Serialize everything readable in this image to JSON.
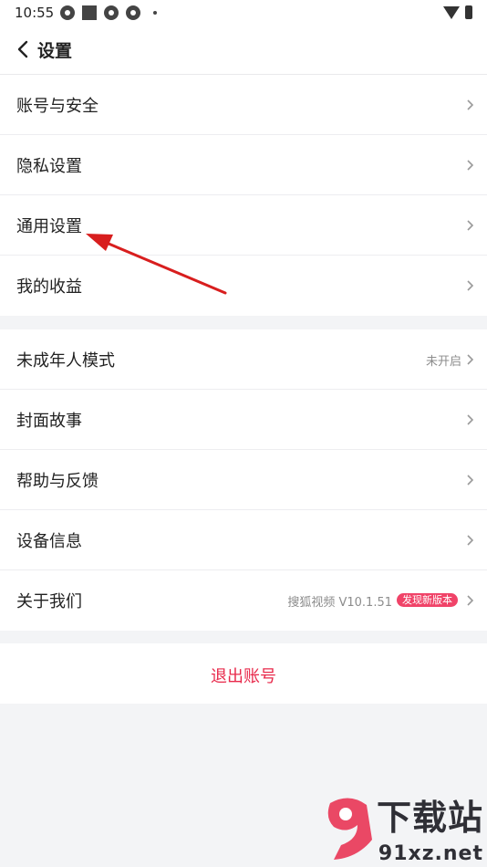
{
  "status_bar": {
    "time": "10:55"
  },
  "header": {
    "title": "设置"
  },
  "group1": [
    {
      "label": "账号与安全"
    },
    {
      "label": "隐私设置"
    },
    {
      "label": "通用设置"
    },
    {
      "label": "我的收益"
    }
  ],
  "group2": [
    {
      "label": "未成年人模式",
      "value": "未开启"
    },
    {
      "label": "封面故事"
    },
    {
      "label": "帮助与反馈"
    },
    {
      "label": "设备信息"
    },
    {
      "label": "关于我们",
      "value": "搜狐视频 V10.1.51",
      "badge": "发现新版本"
    }
  ],
  "logout": {
    "label": "退出账号"
  },
  "watermark": {
    "title": "下载站",
    "sub": "91xz.net"
  },
  "colors": {
    "accent": "#e8294b",
    "badge": "#f04368",
    "arrow": "#d81e1e"
  }
}
